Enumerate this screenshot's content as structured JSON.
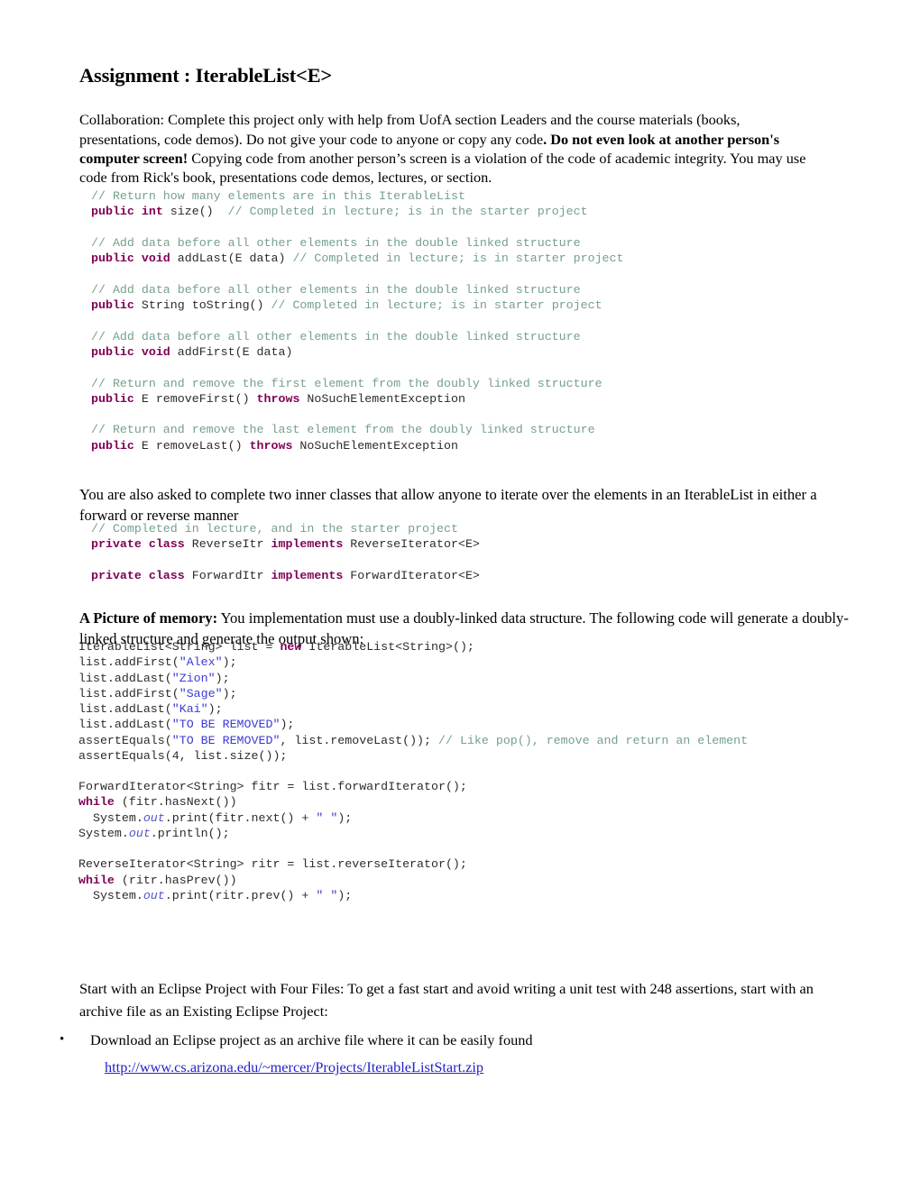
{
  "document": {
    "title": "Assignment : IterableList<E>",
    "paragraphs": {
      "collaboration_p1": "Collaboration: Complete this project only with help from UofA section Leaders and the course materials (books, presentations, code demos).  Do not give your code to anyone or copy any code",
      "collaboration_bold1": ".  Do not even look at another person's computer screen!",
      "collaboration_p2": " Copying code from another person’s screen is a violation of the code of academic integrity. You may use code from Rick's book, presentations code demos, lectures, or section.",
      "inner_classes": "You are also asked to complete two inner classes that allow anyone to iterate over the elements in an IterableList in either a forward or reverse manner",
      "memory_bold": "A Picture of memory:",
      "memory_rest": " You implementation must use a doubly-linked data structure.  The following code will generate a doubly-linked structure and generate the output shown:",
      "eclipse": "Start with an Eclipse Project with Four Files: To get a fast start and avoid writing a unit test with 248 assertions, start with an archive file as an Existing Eclipse Project:"
    },
    "bullet": {
      "marker": "•",
      "text": "Download an Eclipse project as an archive file where it can be easily found",
      "link_text": "http://www.cs.arizona.edu/~mercer/Projects/IterableListStart.zip",
      "link_href": "http://www.cs.arizona.edu/~mercer/Projects/IterableListStart.zip"
    },
    "colors": {
      "keyword": "#7f0055",
      "comment": "#75a08c",
      "string": "#3a3ad4",
      "field": "#5555cc",
      "plain": "#2b2b2b",
      "link": "#2222cc",
      "text": "#000000",
      "background": "#ffffff"
    },
    "code_blocks": {
      "methods": [
        {
          "type": "comment",
          "text": "// Return how many elements are in this IterableList"
        },
        {
          "type": "mixed",
          "tokens": [
            {
              "k": "kw",
              "t": "public int"
            },
            {
              "k": "pln",
              "t": " size()  "
            },
            {
              "k": "cmt",
              "t": "// Completed in lecture; is in the starter project"
            }
          ]
        },
        {
          "type": "blank"
        },
        {
          "type": "comment",
          "text": "// Add data before all other elements in the double linked structure"
        },
        {
          "type": "mixed",
          "tokens": [
            {
              "k": "kw",
              "t": "public void"
            },
            {
              "k": "pln",
              "t": " addLast(E data) "
            },
            {
              "k": "cmt",
              "t": "// Completed in lecture; is in starter project"
            }
          ]
        },
        {
          "type": "blank"
        },
        {
          "type": "comment",
          "text": "// Add data before all other elements in the double linked structure"
        },
        {
          "type": "mixed",
          "tokens": [
            {
              "k": "kw",
              "t": "public"
            },
            {
              "k": "pln",
              "t": " String toString() "
            },
            {
              "k": "cmt",
              "t": "// Completed in lecture; is in starter project"
            }
          ]
        },
        {
          "type": "blank"
        },
        {
          "type": "comment",
          "text": "// Add data before all other elements in the double linked structure"
        },
        {
          "type": "mixed",
          "tokens": [
            {
              "k": "kw",
              "t": "public void"
            },
            {
              "k": "pln",
              "t": " addFirst(E data)"
            }
          ]
        },
        {
          "type": "blank"
        },
        {
          "type": "comment",
          "text": "// Return and remove the first element from the doubly linked structure"
        },
        {
          "type": "mixed",
          "tokens": [
            {
              "k": "kw",
              "t": "public"
            },
            {
              "k": "pln",
              "t": " E removeFirst() "
            },
            {
              "k": "kw",
              "t": "throws"
            },
            {
              "k": "pln",
              "t": " NoSuchElementException"
            }
          ]
        },
        {
          "type": "blank"
        },
        {
          "type": "comment",
          "text": "// Return and remove the last element from the doubly linked structure"
        },
        {
          "type": "mixed",
          "tokens": [
            {
              "k": "kw",
              "t": "public"
            },
            {
              "k": "pln",
              "t": " E removeLast() "
            },
            {
              "k": "kw",
              "t": "throws"
            },
            {
              "k": "pln",
              "t": " NoSuchElementException"
            }
          ]
        }
      ],
      "inner_classes": [
        {
          "type": "comment",
          "text": "// Completed in lecture, and in the starter project"
        },
        {
          "type": "mixed",
          "tokens": [
            {
              "k": "kw",
              "t": "private class"
            },
            {
              "k": "pln",
              "t": " ReverseItr "
            },
            {
              "k": "kw",
              "t": "implements"
            },
            {
              "k": "pln",
              "t": " ReverseIterator<E>"
            }
          ]
        },
        {
          "type": "blank"
        },
        {
          "type": "mixed",
          "tokens": [
            {
              "k": "kw",
              "t": "private class"
            },
            {
              "k": "pln",
              "t": " ForwardItr "
            },
            {
              "k": "kw",
              "t": "implements"
            },
            {
              "k": "pln",
              "t": " ForwardIterator<E>"
            }
          ]
        }
      ],
      "sample": [
        {
          "type": "mixed",
          "tokens": [
            {
              "k": "pln",
              "t": "IterableList<String> list = "
            },
            {
              "k": "kw",
              "t": "new"
            },
            {
              "k": "pln",
              "t": " IterableList<String>();"
            }
          ]
        },
        {
          "type": "mixed",
          "tokens": [
            {
              "k": "pln",
              "t": "list.addFirst("
            },
            {
              "k": "str",
              "t": "\"Alex\""
            },
            {
              "k": "pln",
              "t": ");"
            }
          ]
        },
        {
          "type": "mixed",
          "tokens": [
            {
              "k": "pln",
              "t": "list.addLast("
            },
            {
              "k": "str",
              "t": "\"Zion\""
            },
            {
              "k": "pln",
              "t": ");"
            }
          ]
        },
        {
          "type": "mixed",
          "tokens": [
            {
              "k": "pln",
              "t": "list.addFirst("
            },
            {
              "k": "str",
              "t": "\"Sage\""
            },
            {
              "k": "pln",
              "t": ");"
            }
          ]
        },
        {
          "type": "mixed",
          "tokens": [
            {
              "k": "pln",
              "t": "list.addLast("
            },
            {
              "k": "str",
              "t": "\"Kai\""
            },
            {
              "k": "pln",
              "t": ");"
            }
          ]
        },
        {
          "type": "mixed",
          "tokens": [
            {
              "k": "pln",
              "t": "list.addLast("
            },
            {
              "k": "str",
              "t": "\"TO BE REMOVED\""
            },
            {
              "k": "pln",
              "t": ");"
            }
          ]
        },
        {
          "type": "mixed",
          "tokens": [
            {
              "k": "pln",
              "t": "assertEquals("
            },
            {
              "k": "str",
              "t": "\"TO BE REMOVED\""
            },
            {
              "k": "pln",
              "t": ", list.removeLast()); "
            },
            {
              "k": "cmt",
              "t": "// Like pop(), remove and return an element"
            }
          ]
        },
        {
          "type": "mixed",
          "tokens": [
            {
              "k": "pln",
              "t": "assertEquals(4, list.size());"
            }
          ]
        }
      ],
      "iterators": [
        {
          "type": "mixed",
          "tokens": [
            {
              "k": "pln",
              "t": "ForwardIterator<String> fitr = list.forwardIterator();"
            }
          ]
        },
        {
          "type": "mixed",
          "tokens": [
            {
              "k": "kw",
              "t": "while"
            },
            {
              "k": "pln",
              "t": " (fitr.hasNext())"
            }
          ]
        },
        {
          "type": "mixed",
          "tokens": [
            {
              "k": "pln",
              "t": "  System."
            },
            {
              "k": "fld",
              "t": "out"
            },
            {
              "k": "pln",
              "t": ".print(fitr.next() + "
            },
            {
              "k": "str",
              "t": "\" \""
            },
            {
              "k": "pln",
              "t": ");"
            }
          ]
        },
        {
          "type": "mixed",
          "tokens": [
            {
              "k": "pln",
              "t": "System."
            },
            {
              "k": "fld",
              "t": "out"
            },
            {
              "k": "pln",
              "t": ".println();"
            }
          ]
        },
        {
          "type": "blank"
        },
        {
          "type": "mixed",
          "tokens": [
            {
              "k": "pln",
              "t": "ReverseIterator<String> ritr = list.reverseIterator();"
            }
          ]
        },
        {
          "type": "mixed",
          "tokens": [
            {
              "k": "kw",
              "t": "while"
            },
            {
              "k": "pln",
              "t": " (ritr.hasPrev())"
            }
          ]
        },
        {
          "type": "mixed",
          "tokens": [
            {
              "k": "pln",
              "t": "  System."
            },
            {
              "k": "fld",
              "t": "out"
            },
            {
              "k": "pln",
              "t": ".print(ritr.prev() + "
            },
            {
              "k": "str",
              "t": "\" \""
            },
            {
              "k": "pln",
              "t": ");"
            }
          ]
        }
      ]
    }
  }
}
